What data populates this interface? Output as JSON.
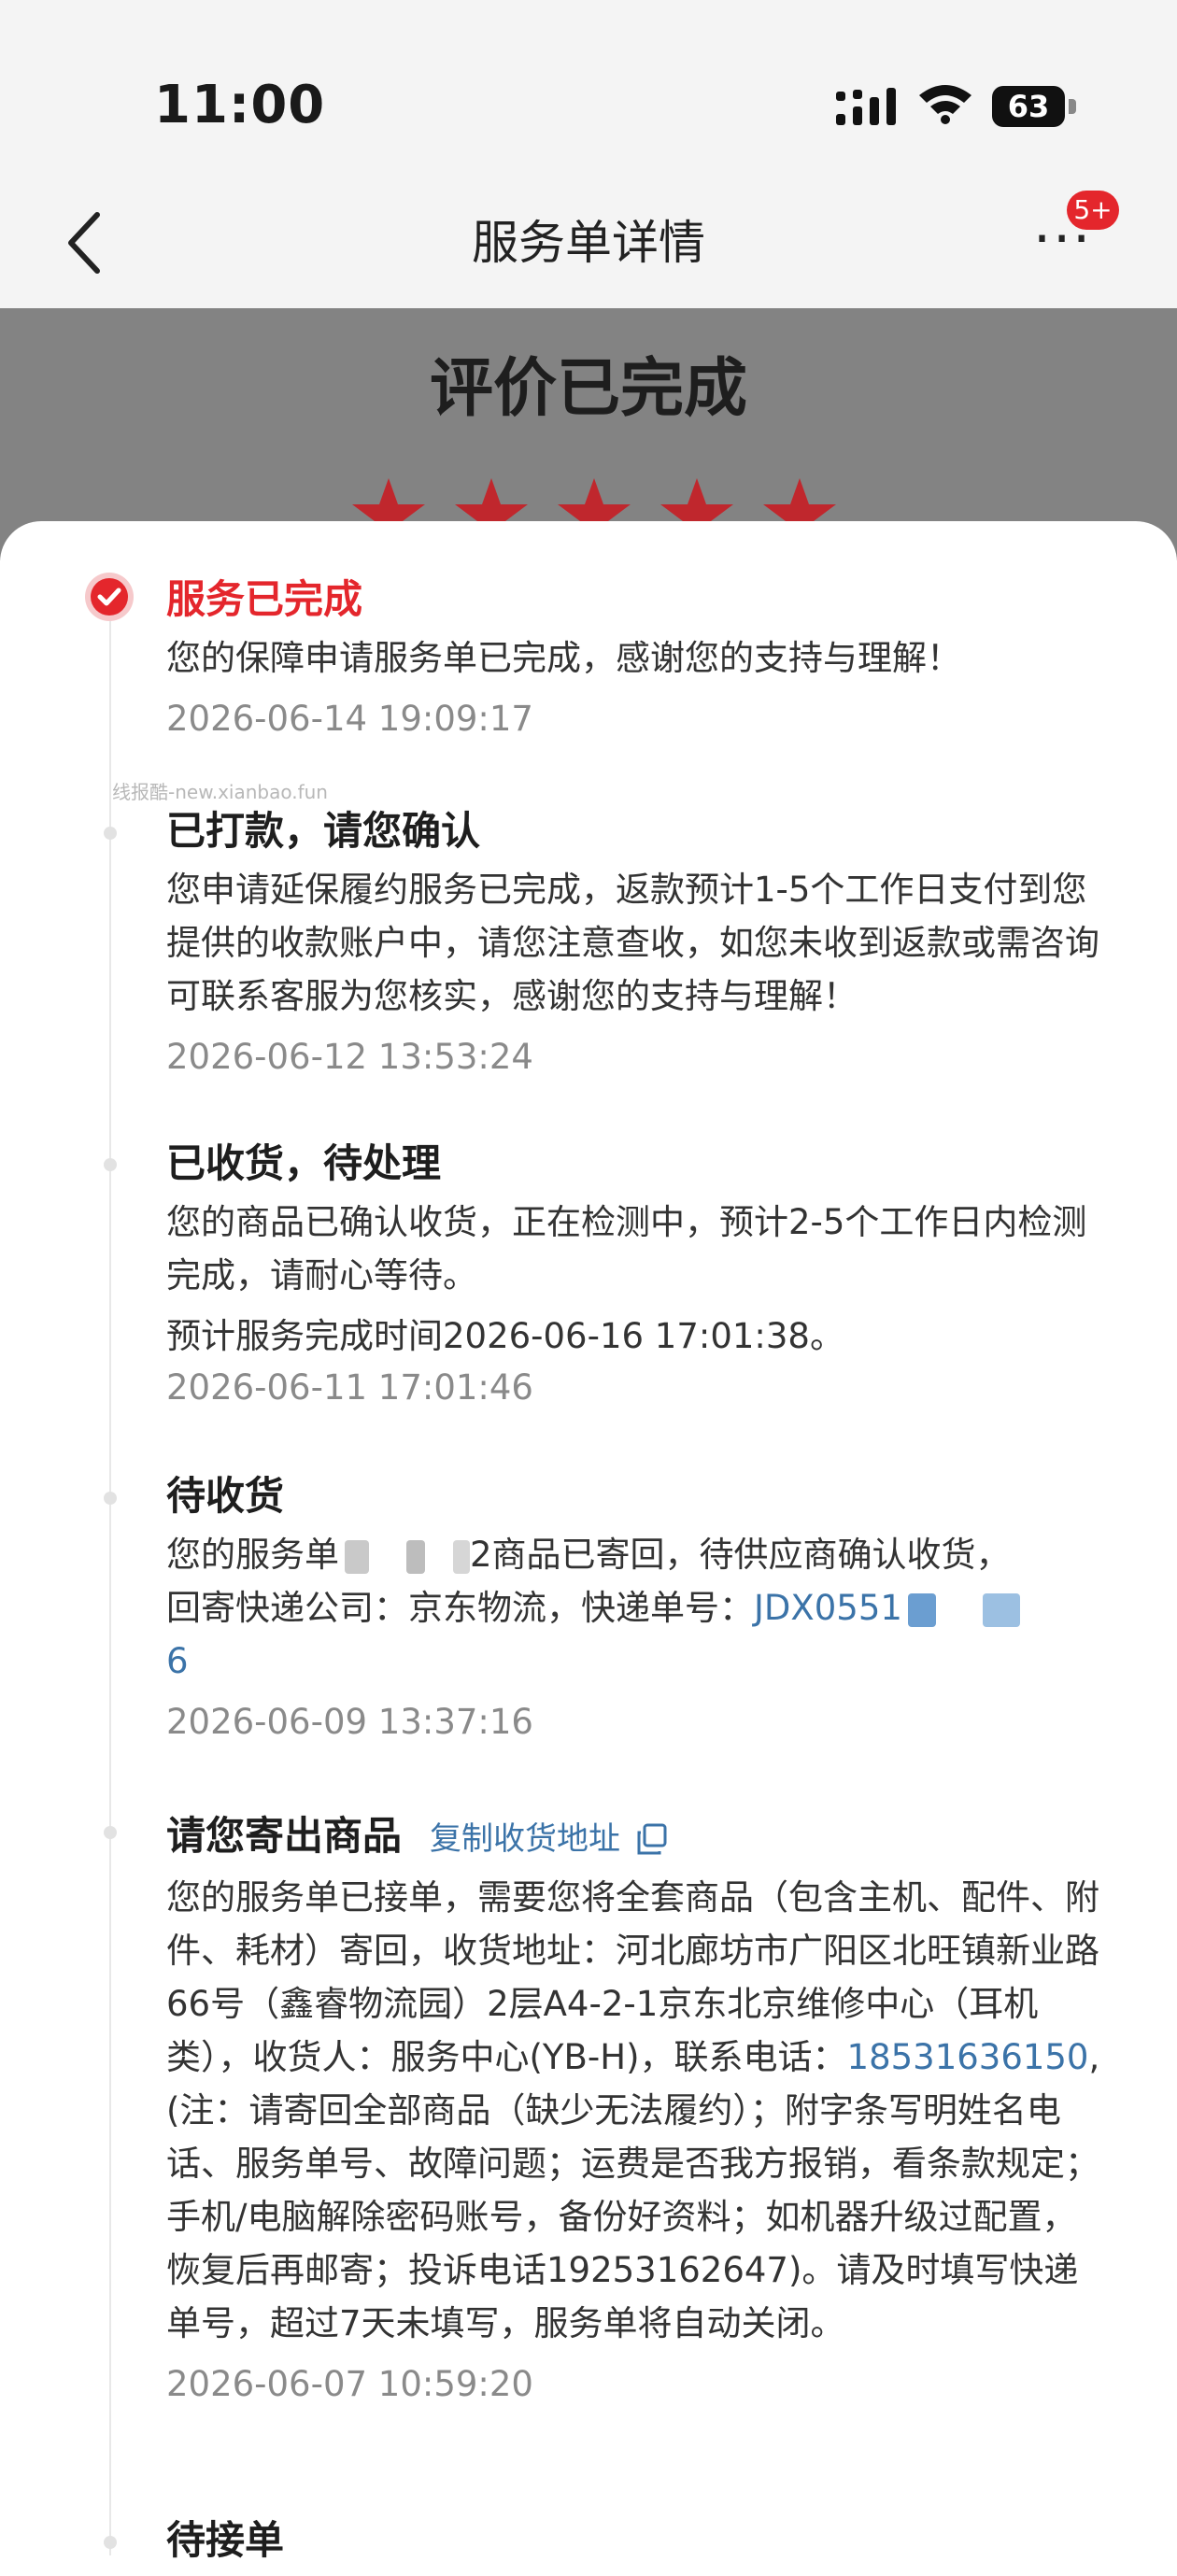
{
  "status_bar": {
    "time": "11:00",
    "battery": "63"
  },
  "nav": {
    "title": "服务单详情",
    "more_icon": "more-dots-icon",
    "badge": "5+"
  },
  "banner": {
    "title": "评价已完成",
    "rating": 5,
    "star_color": "#c0272d"
  },
  "accent_color": "#e4262c",
  "link_color": "#3b73a8",
  "watermark": "线报酷-new.xianbao.fun",
  "events": [
    {
      "title": "服务已完成",
      "desc": "您的保障申请服务单已完成，感谢您的支持与理解！",
      "time": "2026-06-14 19:09:17"
    },
    {
      "title": "已打款，请您确认",
      "desc": "您申请延保履约服务已完成，返款预计1-5个工作日支付到您提供的收款账户中，请您注意查收，如您未收到返款或需咨询可联系客服为您核实，感谢您的支持与理解！",
      "time": "2026-06-12 13:53:24"
    },
    {
      "title": "已收货，待处理",
      "desc": "您的商品已确认收货，正在检测中，预计2-5个工作日内检测完成，请耐心等待。",
      "extra": "预计服务完成时间2026-06-16 17:01:38。",
      "time": "2026-06-11 17:01:46"
    },
    {
      "title": "待收货",
      "desc_a": "您的服务单",
      "desc_b": "2商品已寄回，待供应商确认收货，",
      "desc_c": "回寄快递公司：京东物流，快递单号：",
      "tracking_a": "JDX0551",
      "tracking_b": "6",
      "time": "2026-06-09 13:37:16"
    },
    {
      "title": "请您寄出商品",
      "copy_label": "复制收货地址",
      "desc_a": "您的服务单已接单，需要您将全套商品（包含主机、配件、附件、耗材）寄回，收货地址：河北廊坊市广阳区北旺镇新业路66号（鑫睿物流园）2层A4-2-1京东北京维修中心（耳机类），收货人：服务中心(YB-H)，联系电话：",
      "phone": "18531636150",
      "desc_b": ",(注：请寄回全部商品（缺少无法履约）；附字条写明姓名电话、服务单号、故障问题；运费是否我方报销，看条款规定；手机/电脑解除密码账号，备份好资料；如机器升级过配置，恢复后再邮寄；投诉电话19253162647)。请及时填写快递单号，超过7天未填写，服务单将自动关闭。",
      "time": "2026-06-07 10:59:20"
    },
    {
      "title": "待接单"
    }
  ]
}
